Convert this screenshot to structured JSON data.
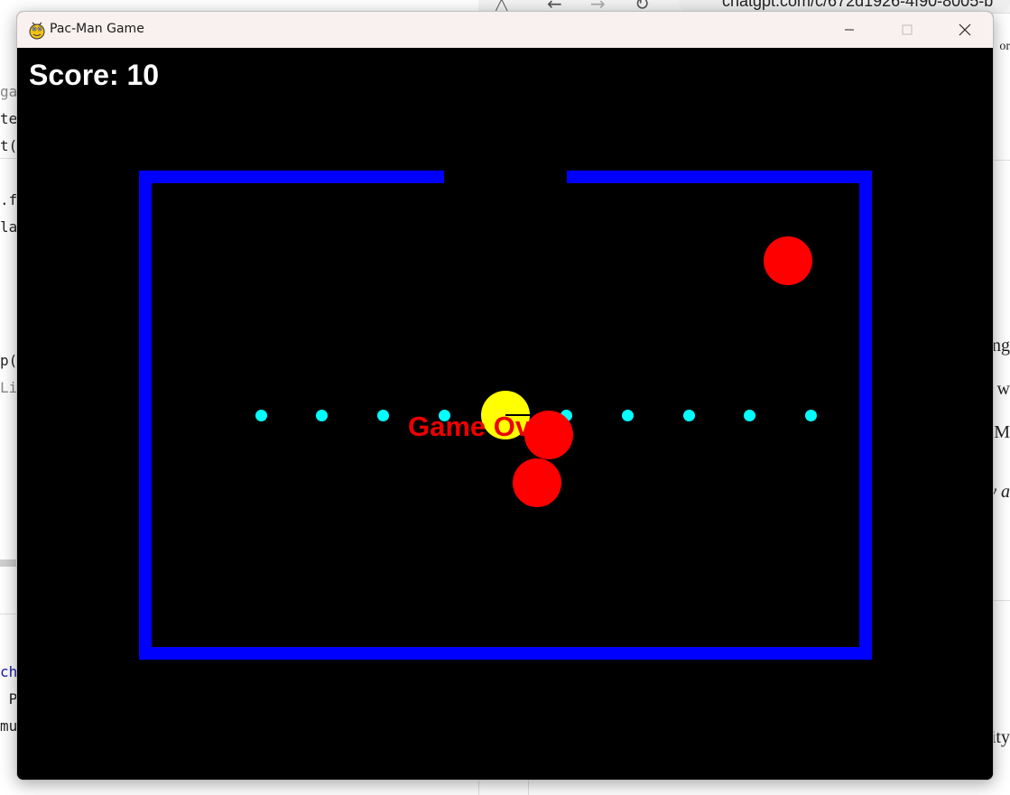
{
  "window": {
    "title": "Pac-Man Game"
  },
  "game": {
    "score_label": "Score: 10",
    "game_over_text": "Game Over!",
    "colors": {
      "wall": "#0000ff",
      "pellet": "#00ffff",
      "pacman": "#ffff00",
      "ghost": "#ff0000",
      "background": "#000000",
      "score_text": "#ffffff",
      "game_over_text": "#ee0000"
    },
    "pellet_count": 9,
    "ghost_count": 3
  },
  "background": {
    "browser_url": "chatgpt.com/c/672d1926-4f90-8005-b",
    "code_fragments": [
      "ga",
      "te",
      "t(",
      ".f",
      "la",
      "p(",
      "Li",
      "ch",
      " P",
      "mu"
    ],
    "right_fragments": [
      "or",
      "ng",
      "w",
      "M",
      "y a",
      "ity"
    ]
  }
}
